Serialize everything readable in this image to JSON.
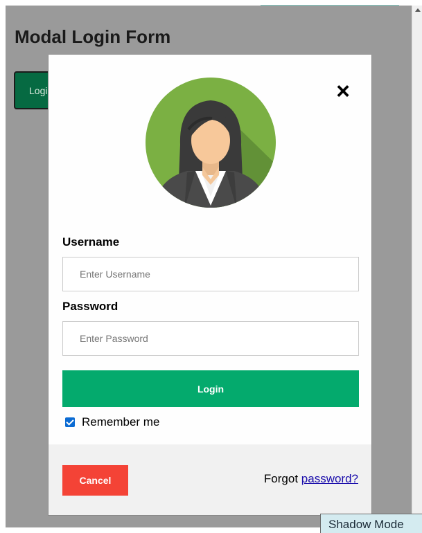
{
  "page": {
    "title": "Modal Login Form",
    "open_button_label": "Login"
  },
  "modal": {
    "close_symbol": "×",
    "username": {
      "label": "Username",
      "placeholder": "Enter Username",
      "value": ""
    },
    "password": {
      "label": "Password",
      "placeholder": "Enter Password",
      "value": ""
    },
    "login_button_label": "Login",
    "remember": {
      "label": "Remember me",
      "checked": true
    },
    "footer": {
      "cancel_label": "Cancel",
      "forgot_prefix": "Forgot",
      "forgot_link": "password?"
    }
  },
  "shadow_mode_tab": "Shadow Mode",
  "icons": {
    "avatar": "woman-avatar-icon",
    "close": "close-icon",
    "checkbox": "checkmark-icon"
  },
  "colors": {
    "overlay": "#9a9a9a",
    "open_button": "#066a42",
    "login_button": "#04aa6d",
    "cancel_button": "#f44336",
    "footer_bg": "#f1f1f1",
    "avatar_bg": "#7bb043",
    "link": "#1a0dab"
  }
}
